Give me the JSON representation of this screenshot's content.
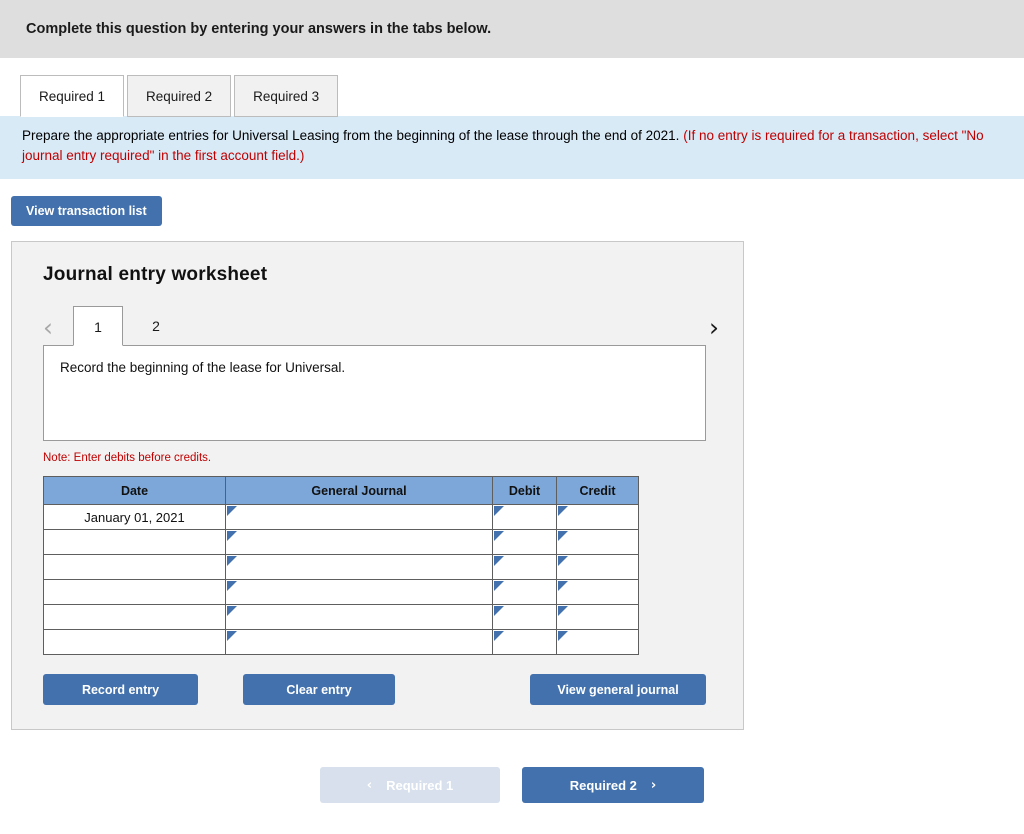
{
  "banner": {
    "title": "Complete this question by entering your answers in the tabs below."
  },
  "tabs": [
    {
      "label": "Required 1",
      "active": true
    },
    {
      "label": "Required 2",
      "active": false
    },
    {
      "label": "Required 3",
      "active": false
    }
  ],
  "instruction": {
    "black_text": "Prepare the appropriate entries for Universal Leasing from the beginning of the lease through the end of 2021.",
    "red_text": "(If no entry is required for a transaction, select \"No journal entry required\" in the first account field.)"
  },
  "toolbar": {
    "view_transaction_list_label": "View transaction list"
  },
  "worksheet": {
    "title": "Journal entry worksheet",
    "pager": {
      "prev_icon": "chevron-left-icon",
      "next_icon": "chevron-right-icon",
      "prev_glyph": "‹",
      "next_glyph": "›",
      "pages": [
        {
          "label": "1",
          "active": true
        },
        {
          "label": "2",
          "active": false
        }
      ]
    },
    "description": "Record the beginning of the lease for Universal.",
    "note": "Note: Enter debits before credits.",
    "table": {
      "columns": [
        "Date",
        "General Journal",
        "Debit",
        "Credit"
      ],
      "rows": [
        {
          "date": "January 01, 2021",
          "general_journal": "",
          "debit": "",
          "credit": ""
        },
        {
          "date": "",
          "general_journal": "",
          "debit": "",
          "credit": ""
        },
        {
          "date": "",
          "general_journal": "",
          "debit": "",
          "credit": ""
        },
        {
          "date": "",
          "general_journal": "",
          "debit": "",
          "credit": ""
        },
        {
          "date": "",
          "general_journal": "",
          "debit": "",
          "credit": ""
        },
        {
          "date": "",
          "general_journal": "",
          "debit": "",
          "credit": ""
        }
      ]
    },
    "buttons": {
      "record_entry": "Record entry",
      "clear_entry": "Clear entry",
      "view_general_journal": "View general journal"
    }
  },
  "bottom_nav": {
    "prev_label": "Required 1",
    "prev_glyph": "‹",
    "prev_disabled": true,
    "next_label": "Required 2",
    "next_glyph": "›"
  },
  "colors": {
    "accent_blue": "#4271ad",
    "table_header_blue": "#7da7d9",
    "instruction_band": "#d9eaf7",
    "banner_gray": "#dedede",
    "panel_gray": "#f2f2f2",
    "note_red": "#c00000",
    "disabled_blue": "#d7e0ec"
  }
}
